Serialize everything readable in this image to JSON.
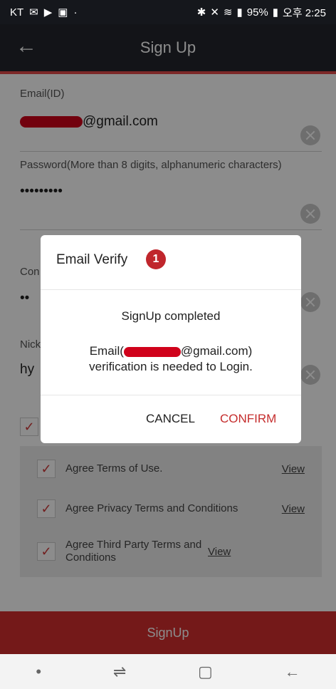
{
  "status_bar": {
    "carrier": "KT",
    "battery": "95%",
    "time": "오후 2:25"
  },
  "app_bar": {
    "title": "Sign Up"
  },
  "form": {
    "email_label": "Email(ID)",
    "email_value_suffix": "@gmail.com",
    "password_label": "Password(More than 8 digits, alphanumeric characters)",
    "password_value": "•••••••••",
    "confirm_label_visible": "Con",
    "confirm_value": "••",
    "nickname_label_visible": "Nick",
    "nickname_value_visible": "hy"
  },
  "agreements": {
    "items": [
      {
        "label": "Agree Terms of Use.",
        "link": "View"
      },
      {
        "label": "Agree Privacy Terms and Conditions",
        "link": "View"
      },
      {
        "label": "Agree Third Party Terms and Conditions",
        "link": "View"
      }
    ]
  },
  "signup_button": "SignUp",
  "dialog": {
    "title": "Email Verify",
    "badge": "1",
    "message_1": "SignUp completed",
    "message_2_prefix": "Email(",
    "message_2_suffix": "@gmail.com)",
    "message_3": "verification is needed to Login.",
    "cancel": "CANCEL",
    "confirm": "CONFIRM"
  },
  "nav": {
    "icons": [
      "dot-icon",
      "recent-apps-icon",
      "home-icon",
      "back-icon"
    ]
  }
}
